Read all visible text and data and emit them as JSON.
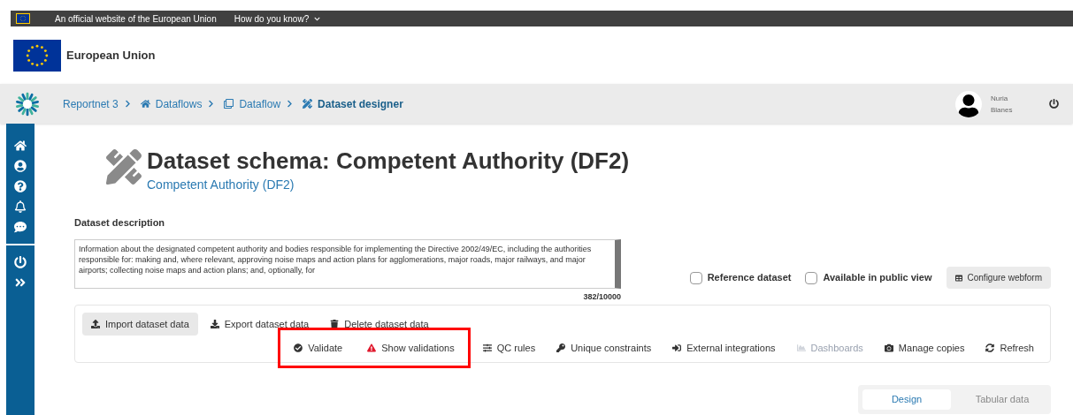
{
  "eu_bar": {
    "notice": "An official website of the European Union",
    "link": "How do you know?"
  },
  "header": {
    "title": "European Union"
  },
  "nav": {
    "breadcrumbs": [
      {
        "label": "Reportnet 3",
        "kind": "text",
        "current": false
      },
      {
        "label": "Dataflows",
        "kind": "home",
        "current": false
      },
      {
        "label": "Dataflow",
        "kind": "clone",
        "current": false
      },
      {
        "label": "Dataset designer",
        "kind": "tools",
        "current": true
      }
    ],
    "user": {
      "first_name": "Nuria",
      "last_name": "Blanes"
    }
  },
  "sidebar": {
    "items": [
      {
        "kind": "home"
      },
      {
        "kind": "user"
      },
      {
        "kind": "help"
      },
      {
        "kind": "bell"
      },
      {
        "kind": "chat"
      },
      {
        "kind": "divider"
      },
      {
        "kind": "power"
      },
      {
        "kind": "expand"
      }
    ]
  },
  "page": {
    "title": "Dataset schema: Competent Authority (DF2)",
    "subtitle": "Competent Authority (DF2)",
    "description_label": "Dataset description",
    "description": "Information about the designated competent authority and bodies responsible for implementing the Directive 2002/49/EC, including the authorities responsible for: making and, where relevant, approving noise maps and action plans for agglomerations, major roads, major railways, and major airports; collecting noise maps and action plans; and, optionally, for",
    "counter": "382/10000",
    "checkboxes": [
      {
        "label": "Reference dataset",
        "checked": false
      },
      {
        "label": "Available in public view",
        "checked": false
      }
    ],
    "webform_button": "Configure webform"
  },
  "toolbar": {
    "row_1": [
      {
        "label": "Import dataset data",
        "kind": "upload",
        "highlighted": true,
        "disabled": false
      },
      {
        "label": "Export dataset data",
        "kind": "download",
        "highlighted": false,
        "disabled": false
      },
      {
        "label": "Delete dataset data",
        "kind": "trash",
        "highlighted": false,
        "disabled": false
      }
    ],
    "row_2": [
      {
        "kind": "framed",
        "items": [
          {
            "label": "Validate",
            "kind": "check",
            "disabled": false
          },
          {
            "label": "Show validations",
            "kind": "warning",
            "disabled": false
          }
        ]
      },
      {
        "kind": "plain",
        "items": [
          {
            "label": "QC rules",
            "kind": "sliders",
            "disabled": false
          },
          {
            "label": "Unique constraints",
            "kind": "key",
            "disabled": false
          },
          {
            "label": "External integrations",
            "kind": "signin",
            "disabled": false
          },
          {
            "label": "Dashboards",
            "kind": "chart",
            "disabled": true
          },
          {
            "label": "Manage copies",
            "kind": "camera",
            "disabled": false
          },
          {
            "label": "Refresh",
            "kind": "sync",
            "disabled": false
          }
        ]
      }
    ]
  },
  "view_tabs": [
    {
      "label": "Design",
      "selected": true
    },
    {
      "label": "Tabular data",
      "selected": false
    }
  ]
}
